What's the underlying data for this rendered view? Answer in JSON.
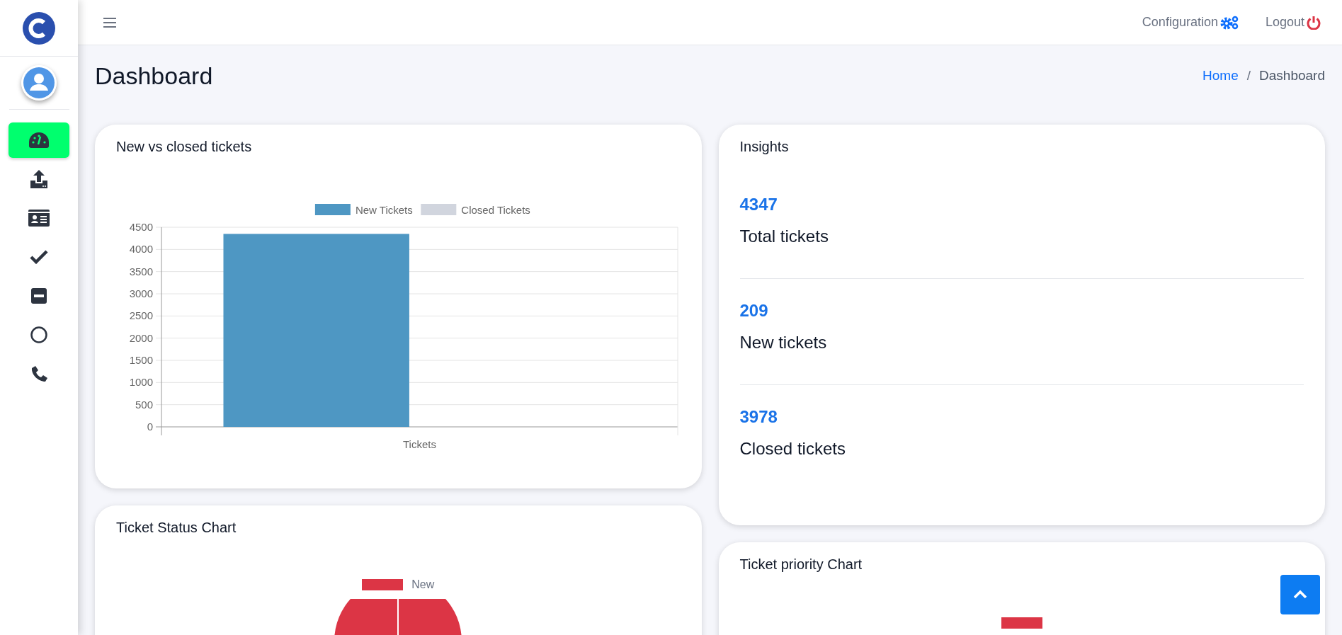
{
  "sidebar": {
    "items": [
      {
        "kind": "gauge",
        "selected": true
      },
      {
        "kind": "upload",
        "selected": false
      },
      {
        "kind": "idcard",
        "selected": false
      },
      {
        "kind": "check",
        "selected": false
      },
      {
        "kind": "minus",
        "selected": false
      },
      {
        "kind": "circle",
        "selected": false
      },
      {
        "kind": "phone",
        "selected": false
      }
    ]
  },
  "header": {
    "links": [
      {
        "kind": "config",
        "label": "Configuration"
      },
      {
        "kind": "logout",
        "label": "Logout"
      }
    ]
  },
  "page": {
    "title": "Dashboard",
    "breadcrumb_separator": "/",
    "breadcrumb": [
      {
        "label": "Home",
        "link": true
      },
      {
        "label": "Dashboard",
        "link": false
      }
    ]
  },
  "bar_card": {
    "title": "New vs closed tickets",
    "chart_data": {
      "type": "bar",
      "categories": [
        "Tickets"
      ],
      "series": [
        {
          "name": "New Tickets",
          "color": "#4e97c3",
          "values": [
            4350
          ]
        },
        {
          "name": "Closed Tickets",
          "color": "#d1d5de",
          "values": [
            null
          ]
        }
      ],
      "ylim": [
        0,
        4500
      ],
      "grid": true,
      "yticks": [
        0,
        500,
        1000,
        1500,
        2000,
        2500,
        3000,
        3500,
        4000,
        4500
      ]
    }
  },
  "insights": {
    "title": "Insights",
    "items": [
      {
        "value": "4347",
        "label": "Total tickets"
      },
      {
        "value": "209",
        "label": "New tickets"
      },
      {
        "value": "3978",
        "label": "Closed tickets"
      }
    ]
  },
  "status_card": {
    "title": "Ticket Status Chart",
    "legend": [
      {
        "label": "New",
        "color": "#dc3545"
      }
    ]
  },
  "priority_card": {
    "title": "Ticket priority Chart",
    "legend": [
      {
        "color": "#dc3545"
      }
    ]
  }
}
